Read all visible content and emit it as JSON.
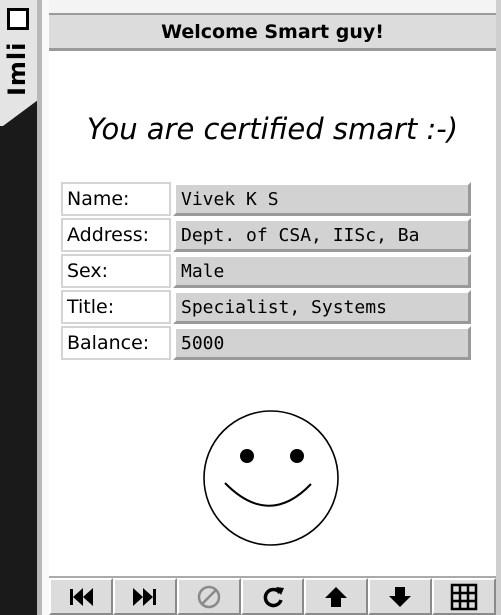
{
  "sidebar": {
    "label": "Imli"
  },
  "window": {
    "title": "Welcome Smart guy!"
  },
  "main": {
    "headline": "You are certified smart :-)",
    "fields": [
      {
        "label": "Name:",
        "value": "Vivek K S"
      },
      {
        "label": "Address:",
        "value": "Dept. of CSA, IISc, Ba"
      },
      {
        "label": "Sex:",
        "value": "Male"
      },
      {
        "label": "Title:",
        "value": "Specialist, Systems"
      },
      {
        "label": "Balance:",
        "value": "5000"
      }
    ]
  },
  "toolbar": {
    "buttons": [
      {
        "icon": "rewind-icon"
      },
      {
        "icon": "fast-forward-icon"
      },
      {
        "icon": "stop-icon"
      },
      {
        "icon": "reload-icon"
      },
      {
        "icon": "arrow-up-icon"
      },
      {
        "icon": "arrow-down-icon"
      },
      {
        "icon": "grid-icon"
      }
    ]
  }
}
